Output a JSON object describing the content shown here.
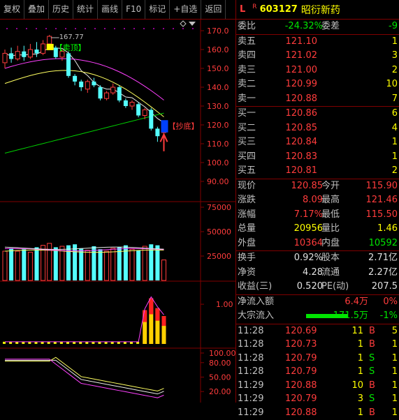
{
  "toolbar": {
    "buttons": [
      "复权",
      "叠加",
      "历史",
      "统计",
      "画线",
      "F10",
      "标记",
      "+自选",
      "返回"
    ]
  },
  "chart": {
    "price_axis": [
      "170.0",
      "160.0",
      "150.0",
      "140.0",
      "130.0",
      "120.0",
      "110.0",
      "100.0",
      "90.00"
    ],
    "max_label": "167.77",
    "sell_top_label": "卖顶",
    "buy_bottom_label": "抄底",
    "volume_axis": [
      "75000",
      "50000",
      "25000"
    ],
    "indicator_axis": [
      "1.00"
    ],
    "kd_axis": [
      "100.00",
      "80.00",
      "50.00",
      "20.00"
    ],
    "candles": [
      {
        "o": 153,
        "c": 158,
        "h": 160,
        "l": 150
      },
      {
        "o": 158,
        "c": 155,
        "h": 161,
        "l": 153
      },
      {
        "o": 155,
        "c": 159,
        "h": 162,
        "l": 154
      },
      {
        "o": 159,
        "c": 156,
        "h": 162,
        "l": 154
      },
      {
        "o": 156,
        "c": 160,
        "h": 163,
        "l": 155
      },
      {
        "o": 160,
        "c": 158,
        "h": 164,
        "l": 156
      },
      {
        "o": 158,
        "c": 163,
        "h": 165,
        "l": 157
      },
      {
        "o": 163,
        "c": 167,
        "h": 167.77,
        "l": 162
      },
      {
        "o": 161,
        "c": 156,
        "h": 162,
        "l": 155
      },
      {
        "o": 156,
        "c": 159,
        "h": 160,
        "l": 154
      },
      {
        "o": 158,
        "c": 146,
        "h": 159,
        "l": 145
      },
      {
        "o": 146,
        "c": 143,
        "h": 147,
        "l": 141
      },
      {
        "o": 143,
        "c": 140,
        "h": 144,
        "l": 138
      },
      {
        "o": 139,
        "c": 143,
        "h": 144,
        "l": 137
      },
      {
        "o": 143,
        "c": 141,
        "h": 145,
        "l": 140
      },
      {
        "o": 140,
        "c": 134,
        "h": 141,
        "l": 133
      },
      {
        "o": 134,
        "c": 137,
        "h": 138,
        "l": 133
      },
      {
        "o": 137,
        "c": 140,
        "h": 142,
        "l": 136
      },
      {
        "o": 140,
        "c": 133,
        "h": 141,
        "l": 132
      },
      {
        "o": 133,
        "c": 130,
        "h": 134,
        "l": 129
      },
      {
        "o": 130,
        "c": 132,
        "h": 133,
        "l": 128
      },
      {
        "o": 131,
        "c": 125,
        "h": 132,
        "l": 124
      },
      {
        "o": 125,
        "c": 128,
        "h": 129,
        "l": 123
      },
      {
        "o": 128,
        "c": 118,
        "h": 129,
        "l": 117
      },
      {
        "o": 118,
        "c": 114,
        "h": 119,
        "l": 111
      },
      {
        "o": 115.9,
        "c": 120.85,
        "h": 121.46,
        "l": 115.5
      }
    ],
    "volumes": [
      30000,
      33000,
      30000,
      32000,
      29000,
      34000,
      36000,
      38000,
      34000,
      35000,
      36000,
      37000,
      33000,
      31000,
      35000,
      32000,
      30000,
      33000,
      34000,
      36000,
      32000,
      31000,
      35000,
      37000,
      36000,
      21000
    ],
    "indicator_values": [
      0.02,
      0.02,
      0.02,
      0.02,
      0.02,
      0.02,
      0.02,
      0.02,
      0.02,
      0.02,
      0.02,
      0.02,
      0.02,
      0.02,
      0.02,
      0.02,
      0.02,
      0.02,
      0.02,
      0.02,
      0.02,
      0.02,
      0.85,
      1.15,
      0.9,
      0.7
    ]
  },
  "quote": {
    "market": "L",
    "flag": "R",
    "code": "603127",
    "name": "昭衍新药",
    "weibi_label": "委比",
    "weibi_value": "-24.32%",
    "weicha_label": "委差",
    "weicha_value": "-9",
    "asks": [
      {
        "label": "卖五",
        "price": "121.10",
        "vol": "1"
      },
      {
        "label": "卖四",
        "price": "121.02",
        "vol": "3"
      },
      {
        "label": "卖三",
        "price": "121.00",
        "vol": "2"
      },
      {
        "label": "卖二",
        "price": "120.99",
        "vol": "10"
      },
      {
        "label": "卖一",
        "price": "120.88",
        "vol": "7"
      }
    ],
    "bids": [
      {
        "label": "买一",
        "price": "120.86",
        "vol": "6"
      },
      {
        "label": "买二",
        "price": "120.85",
        "vol": "4"
      },
      {
        "label": "买三",
        "price": "120.84",
        "vol": "1"
      },
      {
        "label": "买四",
        "price": "120.83",
        "vol": "1"
      },
      {
        "label": "买五",
        "price": "120.81",
        "vol": "2"
      }
    ],
    "stats": [
      {
        "l1": "现价",
        "v1": "120.85",
        "l2": "今开",
        "v2": "115.90"
      },
      {
        "l1": "涨跌",
        "v1": "8.09",
        "l2": "最高",
        "v2": "121.46"
      },
      {
        "l1": "涨幅",
        "v1": "7.17%",
        "l2": "最低",
        "v2": "115.50"
      },
      {
        "l1": "总量",
        "v1": "20956",
        "l2": "量比",
        "v2": "1.46"
      },
      {
        "l1": "外盘",
        "v1": "10364",
        "l2": "内盘",
        "v2": "10592"
      }
    ],
    "extra": [
      {
        "l1": "换手",
        "v1": "0.92%",
        "l2": "股本",
        "v2": "2.71亿"
      },
      {
        "l1": "净资",
        "v1": "4.28",
        "l2": "流通",
        "v2": "2.27亿"
      },
      {
        "l1": "收益(三)",
        "v1": "0.520",
        "l2": "PE(动)",
        "v2": "207.5"
      }
    ],
    "flow": [
      {
        "label": "净流入额",
        "amount": "6.4万",
        "pct": "0%"
      },
      {
        "label": "大宗流入",
        "amount": "-171.5万",
        "pct": "-1%"
      }
    ],
    "ticks": [
      {
        "time": "11:28",
        "price": "120.69",
        "vol": "11",
        "bs": "B",
        "n": "5"
      },
      {
        "time": "11:28",
        "price": "120.73",
        "vol": "1",
        "bs": "B",
        "n": "1"
      },
      {
        "time": "11:28",
        "price": "120.79",
        "vol": "1",
        "bs": "S",
        "n": "1"
      },
      {
        "time": "11:28",
        "price": "120.79",
        "vol": "1",
        "bs": "S",
        "n": "1"
      },
      {
        "time": "11:29",
        "price": "120.88",
        "vol": "10",
        "bs": "B",
        "n": "1"
      },
      {
        "time": "11:29",
        "price": "120.79",
        "vol": "3",
        "bs": "S",
        "n": "1"
      },
      {
        "time": "11:29",
        "price": "120.88",
        "vol": "1",
        "bs": "B",
        "n": "1"
      }
    ]
  }
}
